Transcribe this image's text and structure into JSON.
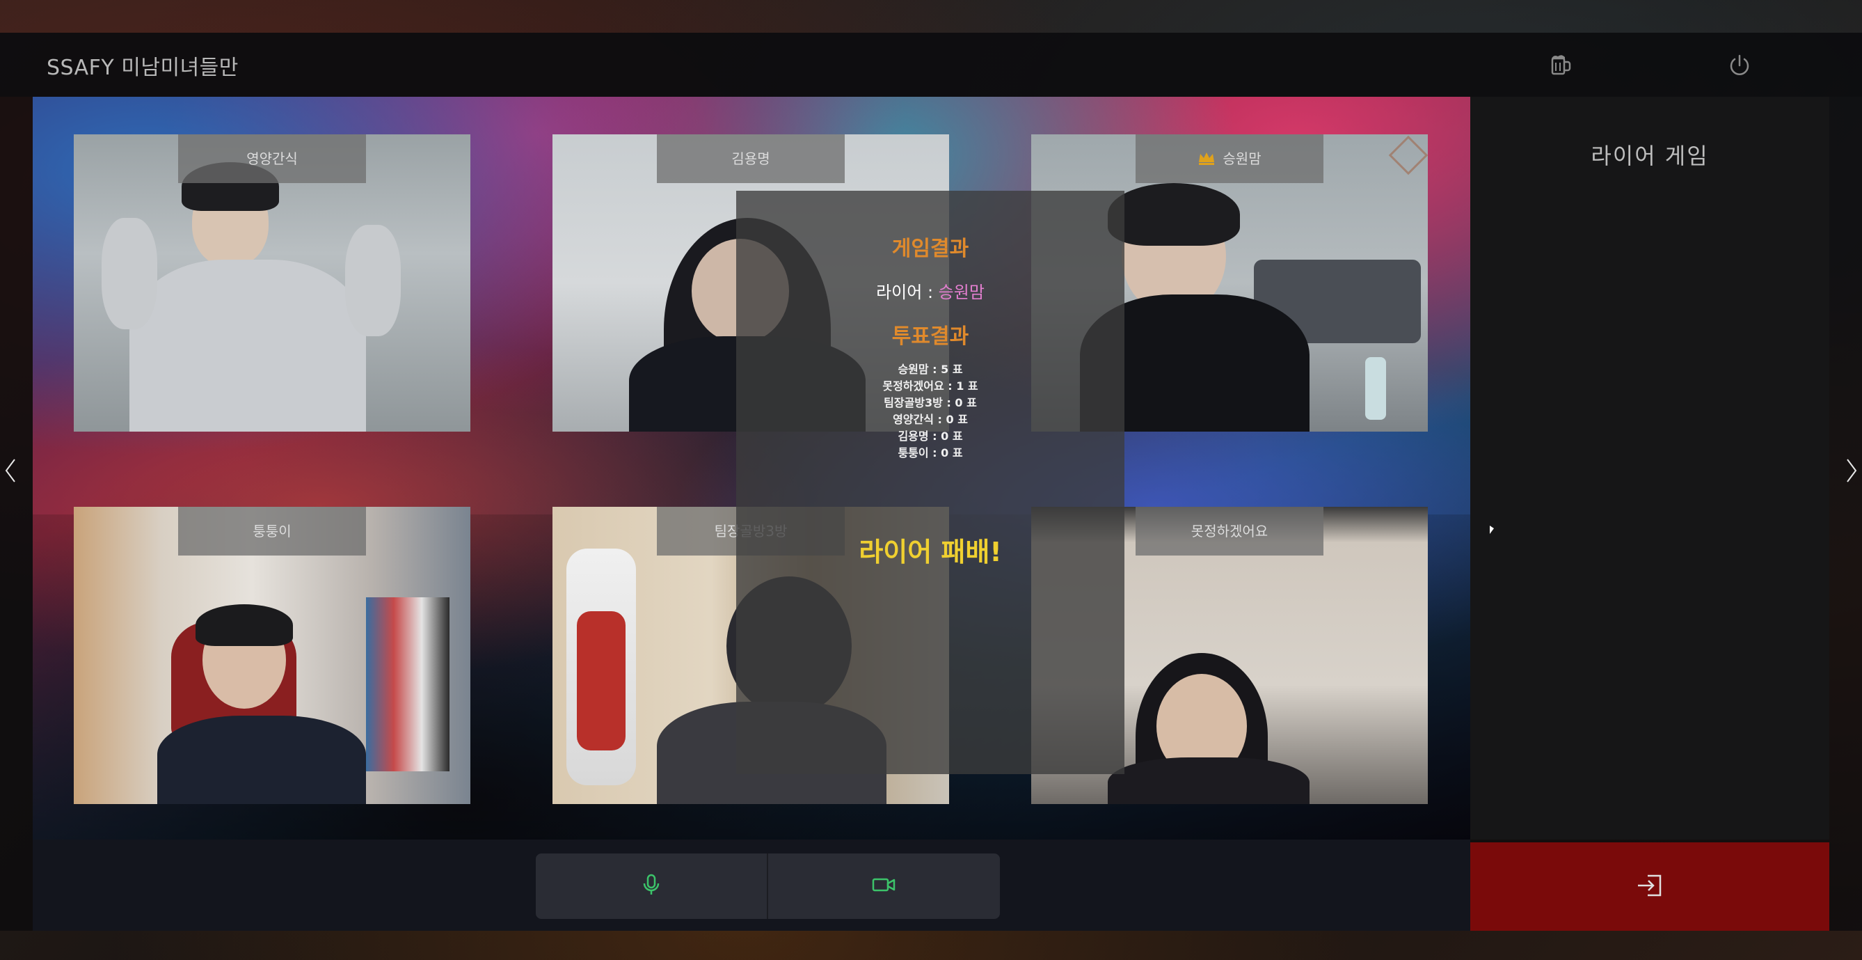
{
  "header": {
    "app_title": "SSAFY 미남미녀들만",
    "beer_icon": "beer-mug-icon",
    "power_icon": "power-icon"
  },
  "participants": [
    {
      "name": "영양간식",
      "host": false
    },
    {
      "name": "김용명",
      "host": false
    },
    {
      "name": "승원맘",
      "host": true
    },
    {
      "name": "퉁퉁이",
      "host": false
    },
    {
      "name": "팀장골방3방",
      "host": false
    },
    {
      "name": "못정하겠어요",
      "host": false
    }
  ],
  "result": {
    "game_result_title": "게임결과",
    "liar_label": "라이어 : ",
    "liar_name": "승원맘",
    "vote_result_title": "투표결과",
    "votes": [
      "승원맘 : 5 표",
      "못정하겠어요 : 1 표",
      "팀장골방3방 : 0 표",
      "영양간식 : 0 표",
      "김용명 : 0 표",
      "퉁퉁이 : 0 표"
    ],
    "outcome": "라이어 패배!"
  },
  "side_panel": {
    "title": "라이어 게임"
  },
  "controls": {
    "mic_icon": "microphone-icon",
    "camera_icon": "video-camera-icon",
    "exit_icon": "exit-icon",
    "mic_color": "#3cc46a",
    "camera_color": "#3cc46a"
  },
  "colors": {
    "game_title": "#e08a2c",
    "liar_name": "#e37fd0",
    "outcome": "#f0d030",
    "exit_bg": "#7a0a0a"
  }
}
